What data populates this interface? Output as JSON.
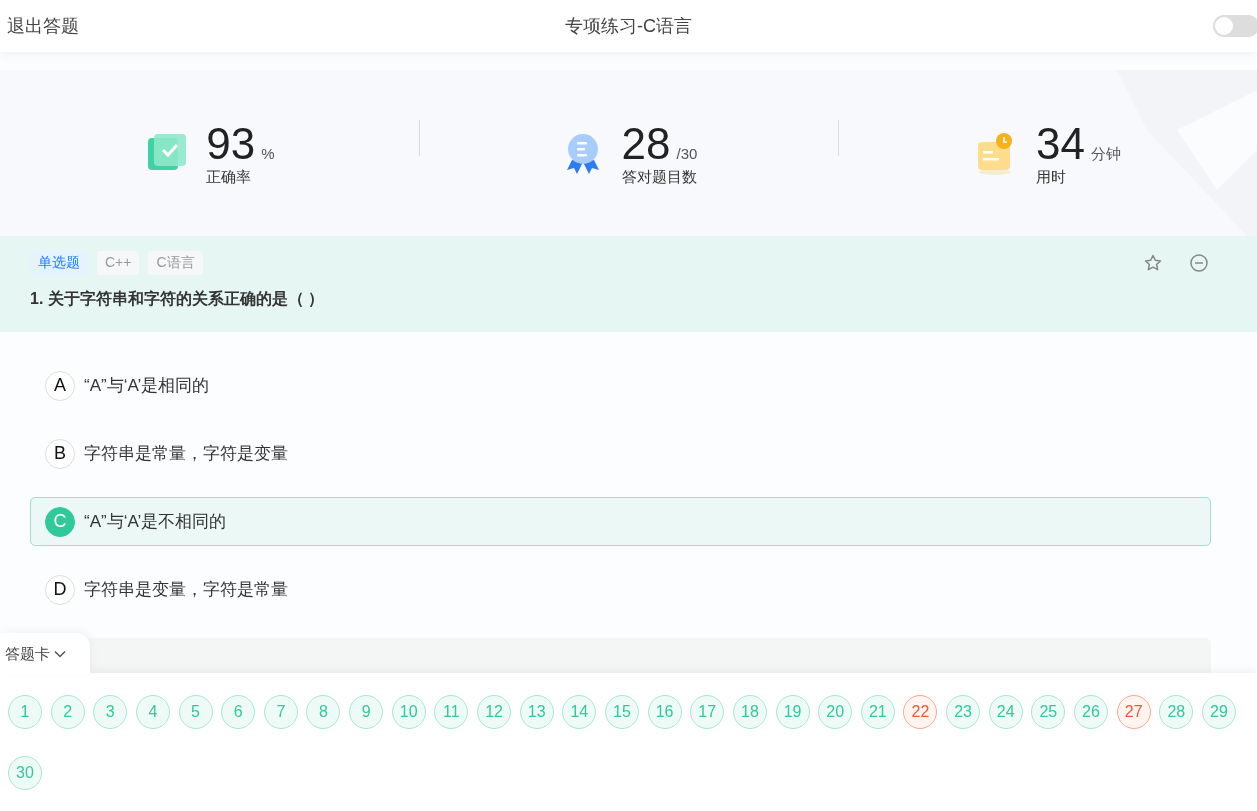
{
  "header": {
    "exit_label": "退出答题",
    "title": "专项练习-C语言",
    "toggle": {
      "on": false
    }
  },
  "stats": [
    {
      "kind": "accuracy",
      "value": "93",
      "unit": "%",
      "label": "正确率"
    },
    {
      "kind": "correct",
      "value": "28",
      "unit": "/30",
      "label": "答对题目数"
    },
    {
      "kind": "time",
      "value": "34",
      "unit": "分钟",
      "label": "用时"
    }
  ],
  "question": {
    "type_tag": "单选题",
    "tags": [
      "C++",
      "C语言"
    ],
    "title": "1. 关于字符串和字符的关系正确的是（ ）",
    "favorited": false,
    "options": [
      {
        "letter": "A",
        "text": "“A”与‘A’是相同的",
        "selected": false
      },
      {
        "letter": "B",
        "text": "字符串是常量，字符是变量",
        "selected": false
      },
      {
        "letter": "C",
        "text": "“A”与‘A’是不相同的",
        "selected": true
      },
      {
        "letter": "D",
        "text": "字符串是变量，字符是常量",
        "selected": false
      }
    ]
  },
  "answer_card": {
    "label": "答题卡",
    "expanded": true,
    "items": [
      {
        "number": "1",
        "kind": "correct"
      },
      {
        "number": "2",
        "kind": "correct"
      },
      {
        "number": "3",
        "kind": "correct"
      },
      {
        "number": "4",
        "kind": "correct"
      },
      {
        "number": "5",
        "kind": "correct"
      },
      {
        "number": "6",
        "kind": "correct"
      },
      {
        "number": "7",
        "kind": "correct"
      },
      {
        "number": "8",
        "kind": "correct"
      },
      {
        "number": "9",
        "kind": "correct"
      },
      {
        "number": "10",
        "kind": "correct"
      },
      {
        "number": "11",
        "kind": "correct"
      },
      {
        "number": "12",
        "kind": "correct"
      },
      {
        "number": "13",
        "kind": "correct"
      },
      {
        "number": "14",
        "kind": "correct"
      },
      {
        "number": "15",
        "kind": "correct"
      },
      {
        "number": "16",
        "kind": "correct"
      },
      {
        "number": "17",
        "kind": "correct"
      },
      {
        "number": "18",
        "kind": "correct"
      },
      {
        "number": "19",
        "kind": "correct"
      },
      {
        "number": "20",
        "kind": "correct"
      },
      {
        "number": "21",
        "kind": "correct"
      },
      {
        "number": "22",
        "kind": "wrong"
      },
      {
        "number": "23",
        "kind": "correct"
      },
      {
        "number": "24",
        "kind": "correct"
      },
      {
        "number": "25",
        "kind": "correct"
      },
      {
        "number": "26",
        "kind": "correct"
      },
      {
        "number": "27",
        "kind": "wrong"
      },
      {
        "number": "28",
        "kind": "correct"
      },
      {
        "number": "29",
        "kind": "correct"
      },
      {
        "number": "30",
        "kind": "correct"
      }
    ]
  }
}
